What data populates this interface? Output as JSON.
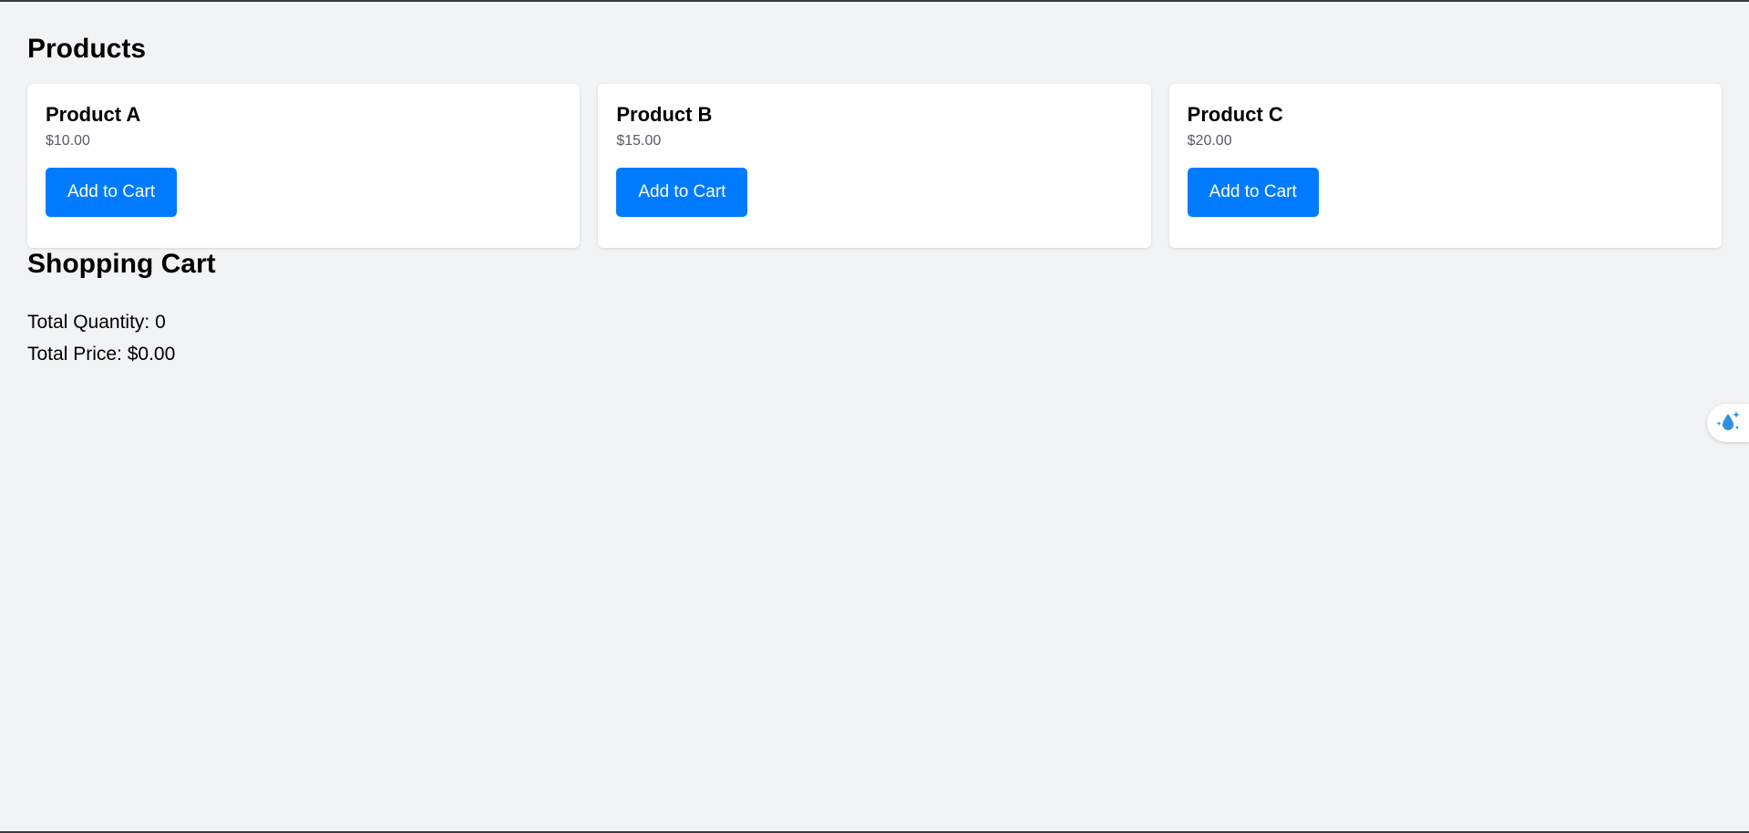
{
  "products": {
    "title": "Products",
    "items": [
      {
        "name": "Product A",
        "price": "$10.00",
        "button_label": "Add to Cart"
      },
      {
        "name": "Product B",
        "price": "$15.00",
        "button_label": "Add to Cart"
      },
      {
        "name": "Product C",
        "price": "$20.00",
        "button_label": "Add to Cart"
      }
    ]
  },
  "cart": {
    "title": "Shopping Cart",
    "total_quantity": "Total Quantity: 0",
    "total_price": "Total Price: $0.00"
  },
  "widget": {
    "icon": "water-drop-sparkle-icon"
  },
  "colors": {
    "background": "#f2f3f5",
    "card": "#ffffff",
    "button": "#007bff",
    "button_text": "#ffffff",
    "price_text": "#555b66"
  }
}
